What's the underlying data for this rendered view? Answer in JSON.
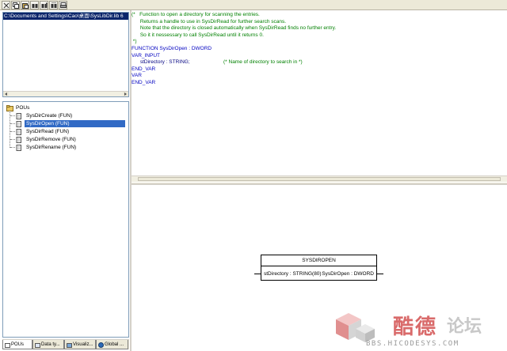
{
  "toolbar": {
    "buttons": [
      "cut-icon",
      "copy-icon",
      "paste-icon",
      "find-icon",
      "find-next-icon",
      "replace-icon",
      "print-icon"
    ]
  },
  "library": {
    "path": "C:\\Documents and Settings\\Cao\\桌面\\SysLibDir.lib 6"
  },
  "tree": {
    "root": "POUs",
    "items": [
      {
        "label": "SysDirCreate (FUN)",
        "selected": false
      },
      {
        "label": "SysDirOpen (FUN)",
        "selected": true
      },
      {
        "label": "SysDirRead (FUN)",
        "selected": false
      },
      {
        "label": "SysDirRemove (FUN)",
        "selected": false
      },
      {
        "label": "SysDirRename (FUN)",
        "selected": false
      }
    ]
  },
  "tabs": [
    {
      "label": "POUs",
      "active": true
    },
    {
      "label": "Data ty...",
      "active": false
    },
    {
      "label": "Visualiz...",
      "active": false
    },
    {
      "label": "Global ...",
      "active": false
    }
  ],
  "declaration": {
    "lines": [
      {
        "text": "(*   Function to open a directory for scanning the entries.",
        "kind": "comment"
      },
      {
        "text": "      Returns a handle to use in SysDirRead for further search scans.",
        "kind": "comment"
      },
      {
        "text": "      Note that the directory is closed automatically when SysDirRead finds no further entry.",
        "kind": "comment"
      },
      {
        "text": "      So it it nessessary to call SysDirRead until it returns 0.",
        "kind": "comment"
      },
      {
        "text": " *)",
        "kind": "comment"
      },
      {
        "text": "FUNCTION SysDirOpen : DWORD",
        "kind": "kw"
      },
      {
        "text": "VAR_INPUT",
        "kind": "kw"
      },
      {
        "text": "      stDirectory : STRING;",
        "kind": "plain",
        "comment": "(* Name of directory to search in *)"
      },
      {
        "text": "END_VAR",
        "kind": "kw"
      },
      {
        "text": "VAR",
        "kind": "kw"
      },
      {
        "text": "END_VAR",
        "kind": "kw"
      }
    ]
  },
  "function_block": {
    "name": "SYSDIROPEN",
    "input": "stDirectory : STRING(80)",
    "output": "SysDirOpen : DWORD"
  },
  "watermark": {
    "brand_red": "酷德",
    "brand_grey": "论坛",
    "url": "BBS.HICODESYS.COM"
  },
  "colors": {
    "selection": "#316ac5",
    "comment": "#008000",
    "keyword": "#0000c0",
    "path_bar": "#0a246a"
  }
}
